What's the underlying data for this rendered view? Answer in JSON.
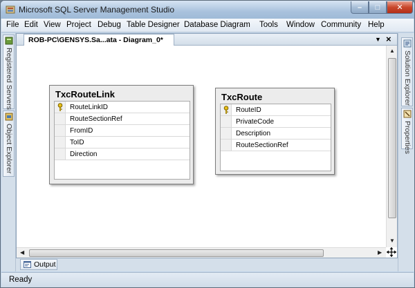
{
  "window": {
    "title": "Microsoft SQL Server Management Studio",
    "minimize_glyph": "–",
    "maximize_glyph": "□",
    "close_glyph": "✕"
  },
  "menu": {
    "items": [
      "File",
      "Edit",
      "View",
      "Project",
      "Debug",
      "Table Designer",
      "Database Diagram",
      "Tools",
      "Window",
      "Community",
      "Help"
    ]
  },
  "left_panels": {
    "registered_servers": "Registered Servers",
    "object_explorer": "Object Explorer"
  },
  "right_panels": {
    "solution_explorer": "Solution Explorer",
    "properties": "Properties"
  },
  "document": {
    "tab_label": "ROB-PC\\GENSYS.Sa...ata - Diagram_0*",
    "dropdown_glyph": "▼",
    "close_glyph": "×"
  },
  "diagram": {
    "tables": [
      {
        "name": "TxcRouteLink",
        "columns": [
          {
            "name": "RouteLinkID",
            "primary_key": true
          },
          {
            "name": "RouteSectionRef",
            "primary_key": false
          },
          {
            "name": "FromID",
            "primary_key": false
          },
          {
            "name": "ToID",
            "primary_key": false
          },
          {
            "name": "Direction",
            "primary_key": false
          }
        ]
      },
      {
        "name": "TxcRoute",
        "columns": [
          {
            "name": "RouteID",
            "primary_key": true
          },
          {
            "name": "PrivateCode",
            "primary_key": false
          },
          {
            "name": "Description",
            "primary_key": false
          },
          {
            "name": "RouteSectionRef",
            "primary_key": false
          }
        ]
      }
    ]
  },
  "output_panel": {
    "label": "Output"
  },
  "statusbar": {
    "text": "Ready"
  },
  "colors": {
    "accent": "#a9c2dd",
    "key_icon": "#e8c01a"
  },
  "icons": {
    "app": "ssms-app-icon",
    "primary_key": "key-icon",
    "pan": "move-arrows-icon",
    "output": "output-window-icon"
  }
}
